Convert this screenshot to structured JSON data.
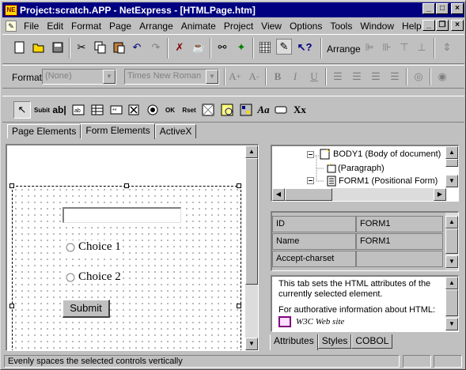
{
  "window": {
    "title": "Project:scratch.APP - NetExpress - [HTMLPage.htm]",
    "app_icon": "NE",
    "min_label": "_",
    "max_label": "□",
    "close_label": "×"
  },
  "menubar": {
    "items": [
      {
        "label": "File"
      },
      {
        "label": "Edit"
      },
      {
        "label": "Format"
      },
      {
        "label": "Page"
      },
      {
        "label": "Arrange"
      },
      {
        "label": "Animate"
      },
      {
        "label": "Project"
      },
      {
        "label": "View"
      },
      {
        "label": "Options"
      },
      {
        "label": "Tools"
      },
      {
        "label": "Window"
      },
      {
        "label": "Help"
      }
    ],
    "mdi_min": "_",
    "mdi_restore": "❐",
    "mdi_close": "×"
  },
  "toolbar1": {
    "arrange_label": "Arrange"
  },
  "toolbar2": {
    "format_label": "Format",
    "style_value": "(None)",
    "font_value": "Times New Roman"
  },
  "toolbar3": {
    "tools": [
      "pointer",
      "submit",
      "abl",
      "ab",
      "table",
      "text",
      "checkbox",
      "radio",
      "ok",
      "reset",
      "image",
      "imagemap",
      "form",
      "Aa",
      "input",
      "Xx"
    ],
    "submit_text": "Subit",
    "abl_text": "ab|",
    "ok_text": "OK",
    "reset_text": "Rset",
    "aa_text": "Aa",
    "xx_text": "Xx"
  },
  "elementtabs": {
    "items": [
      {
        "label": "Page Elements"
      },
      {
        "label": "Form Elements"
      },
      {
        "label": "ActiveX"
      }
    ]
  },
  "form": {
    "textfield_value": "",
    "choice1": "Choice 1",
    "choice2": "Choice 2",
    "submit_label": "Submit"
  },
  "tree": {
    "items": [
      {
        "label": "BODY1 (Body of document)"
      },
      {
        "label": "(Paragraph)"
      },
      {
        "label": "FORM1 (Positional Form)"
      }
    ]
  },
  "props": {
    "rows": [
      {
        "name": "ID",
        "value": "FORM1"
      },
      {
        "name": "Name",
        "value": "FORM1"
      },
      {
        "name": "Accept-charset",
        "value": ""
      }
    ]
  },
  "helpbox": {
    "line1": "This tab sets the HTML attributes of the currently selected element.",
    "line2": "For authorative information about HTML:",
    "link": "W3C Web site"
  },
  "bottomtabs": {
    "items": [
      {
        "label": "Attributes"
      },
      {
        "label": "Styles"
      },
      {
        "label": "COBOL"
      }
    ]
  },
  "status": {
    "text": "Evenly spaces the selected controls vertically"
  },
  "colors": {
    "title_bg": "#000080",
    "face": "#c0c0c0"
  }
}
